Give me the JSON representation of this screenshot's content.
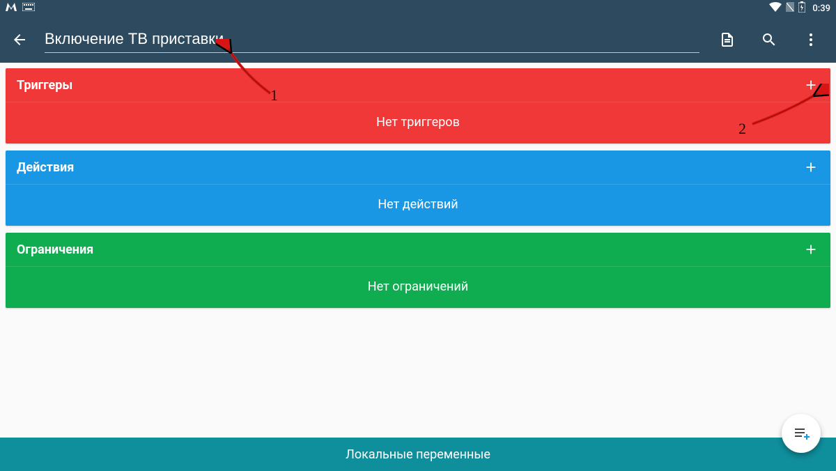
{
  "status_bar": {
    "time": "0:39"
  },
  "app_bar": {
    "title_value": "Включение ТВ приставки"
  },
  "sections": {
    "triggers": {
      "title": "Триггеры",
      "empty_text": "Нет триггеров"
    },
    "actions": {
      "title": "Действия",
      "empty_text": "Нет действий"
    },
    "constraints": {
      "title": "Ограничения",
      "empty_text": "Нет ограничений"
    }
  },
  "bottom_bar": {
    "label": "Локальные переменные"
  },
  "annotations": {
    "a1": "1",
    "a2": "2"
  },
  "colors": {
    "app_bar_bg": "#2d4a5f",
    "triggers_bg": "#ef3837",
    "actions_bg": "#1997e5",
    "constraints_bg": "#10ac50",
    "bottom_bg": "#0f8e9b"
  }
}
